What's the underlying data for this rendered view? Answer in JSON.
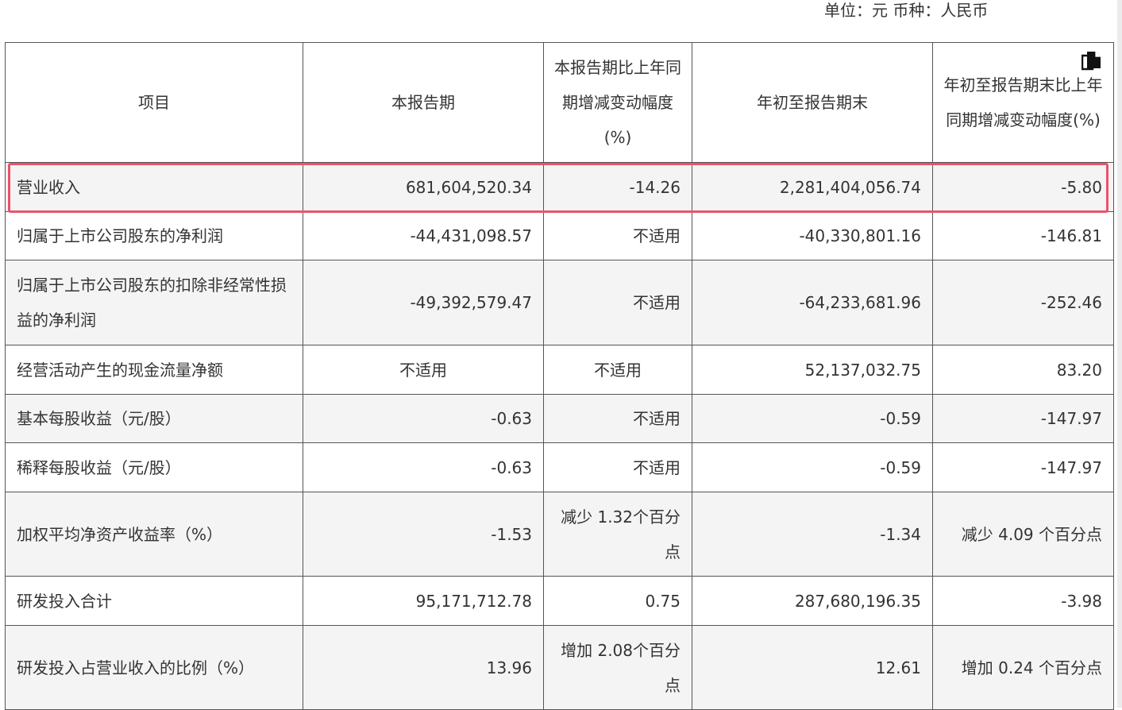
{
  "unit_line": "单位：元  币种：人民币",
  "table": {
    "headers": {
      "item": "项目",
      "current_period": "本报告期",
      "current_yoy_change": "本报告期比上年同期增减变动幅度(%)",
      "ytd": "年初至报告期末",
      "ytd_yoy_change": "年初至报告期末比上年同期增减变动幅度(%)"
    },
    "rows": [
      {
        "item": "营业收入",
        "current": "681,604,520.34",
        "current_change": "-14.26",
        "ytd": "2,281,404,056.74",
        "ytd_change": "-5.80"
      },
      {
        "item": "归属于上市公司股东的净利润",
        "current": "-44,431,098.57",
        "current_change": "不适用",
        "ytd": "-40,330,801.16",
        "ytd_change": "-146.81"
      },
      {
        "item": "归属于上市公司股东的扣除非经常性损益的净利润",
        "current": "-49,392,579.47",
        "current_change": "不适用",
        "ytd": "-64,233,681.96",
        "ytd_change": "-252.46"
      },
      {
        "item": "经营活动产生的现金流量净额",
        "current": "不适用",
        "current_change": "不适用",
        "ytd": "52,137,032.75",
        "ytd_change": "83.20"
      },
      {
        "item": "基本每股收益（元/股）",
        "current": "-0.63",
        "current_change": "不适用",
        "ytd": "-0.59",
        "ytd_change": "-147.97"
      },
      {
        "item": "稀释每股收益（元/股）",
        "current": "-0.63",
        "current_change": "不适用",
        "ytd": "-0.59",
        "ytd_change": "-147.97"
      },
      {
        "item": "加权平均净资产收益率（%）",
        "current": "-1.53",
        "current_change": "减少 1.32个百分点",
        "ytd": "-1.34",
        "ytd_change": "减少 4.09 个百分点"
      },
      {
        "item": "研发投入合计",
        "current": "95,171,712.78",
        "current_change": "0.75",
        "ytd": "287,680,196.35",
        "ytd_change": "-3.98"
      },
      {
        "item": "研发投入占营业收入的比例（%）",
        "current": "13.96",
        "current_change": "增加 2.08个百分点",
        "ytd": "12.61",
        "ytd_change": "增加 0.24 个百分点"
      }
    ]
  },
  "highlight_color": "#e8546b",
  "icons": {
    "copy": "copy-icon"
  }
}
